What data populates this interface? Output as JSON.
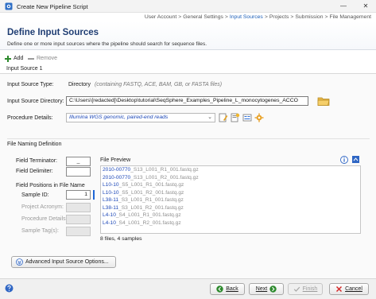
{
  "window": {
    "title": "Create New Pipeline Script",
    "controls": {
      "minimize": "—",
      "close": "✕"
    }
  },
  "breadcrumb": {
    "items": [
      "User Account",
      "General Settings",
      "Input Sources",
      "Projects",
      "Submission",
      "File Management"
    ],
    "active_index": 2,
    "separator": ">"
  },
  "header": {
    "title": "Define Input Sources",
    "subtitle": "Define one or more input sources where the pipeline should search for sequence files."
  },
  "toolbar": {
    "add_label": "Add",
    "remove_label": "Remove"
  },
  "tab": {
    "label": "Input Source 1"
  },
  "form": {
    "source_type_label": "Input Source Type:",
    "source_type_value": "Directory",
    "source_type_hint": "(containing FASTQ, ACE, BAM, GB, or FASTA files)",
    "directory_label": "Input Source Directory:",
    "directory_value": "C:\\Users\\[redacted]\\Desktop\\tutorial\\SeqSphere_Examples_Pipeline_L_monocytogenes_ACCO",
    "procedure_label": "Procedure Details:",
    "procedure_value": "Illumina WGS genomic, paired-end reads"
  },
  "naming": {
    "section_title": "File Naming Definition",
    "field_terminator_label": "Field Terminator:",
    "field_terminator_value": "_",
    "field_delimiter_label": "Field Delimiter:",
    "field_delimiter_value": "",
    "positions_label": "Field Positions in File Name",
    "sample_id_label": "Sample ID:",
    "sample_id_value": "1",
    "project_acronym_label": "Project Acronym:",
    "procedure_details_label": "Procedure Details:",
    "sample_tags_label": "Sample Tag(s):"
  },
  "preview": {
    "title": "File Preview",
    "files": [
      {
        "prefix": "2010-00770",
        "rest": "_S13_L001_R1_001.fastq.gz"
      },
      {
        "prefix": "2010-00770",
        "rest": "_S13_L001_R2_001.fastq.gz"
      },
      {
        "prefix": "L10-10",
        "rest": "_S5_L001_R1_001.fastq.gz"
      },
      {
        "prefix": "L10-10",
        "rest": "_S5_L001_R2_001.fastq.gz"
      },
      {
        "prefix": "L38-11",
        "rest": "_S3_L001_R1_001.fastq.gz"
      },
      {
        "prefix": "L38-11",
        "rest": "_S3_L001_R2_001.fastq.gz"
      },
      {
        "prefix": "L4-10",
        "rest": "_S4_L001_R1_001.fastq.gz"
      },
      {
        "prefix": "L4-10",
        "rest": "_S4_L001_R2_001.fastq.gz"
      }
    ],
    "summary": "8 files, 4 samples"
  },
  "advanced_button": {
    "label": "Advanced Input Source Options..."
  },
  "footer": {
    "back_label": "Back",
    "next_label": "Next",
    "finish_label": "Finish",
    "cancel_label": "Cancel"
  },
  "colors": {
    "accent": "#1f3d73",
    "link_blue": "#1d48b8",
    "active_crumb": "#1d5fb8"
  },
  "icons": {
    "app": "pipeline-app-icon",
    "add": "plus-icon",
    "remove": "minus-icon",
    "folder": "folder-icon",
    "info": "info-icon",
    "help": "help-icon"
  }
}
